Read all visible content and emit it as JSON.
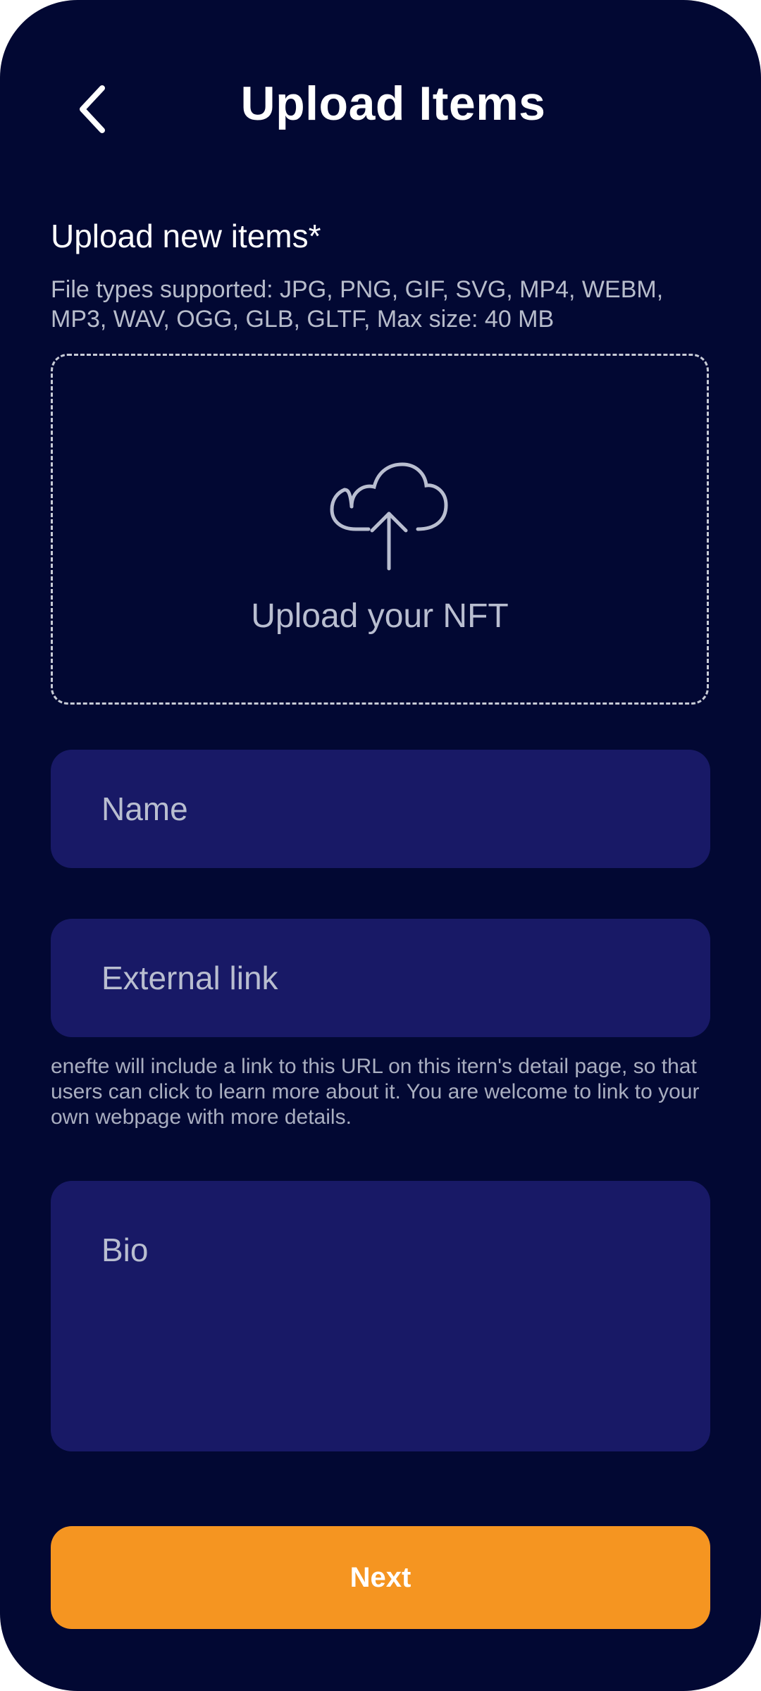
{
  "header": {
    "title": "Upload Items",
    "back_icon": "chevron-left-icon"
  },
  "upload": {
    "section_title": "Upload new items*",
    "description": "File types supported: JPG, PNG, GIF, SVG, MP4, WEBM, MP3, WAV, OGG, GLB, GLTF, Max size: 40 MB",
    "dropzone_label": "Upload your NFT",
    "icon": "cloud-upload-icon"
  },
  "form": {
    "name_placeholder": "Name",
    "name_value": "",
    "link_placeholder": "External link",
    "link_value": "",
    "link_helper": "enefte will include a link to this URL on this itern's detail page, so that users can click to learn more about it. You are welcome to link to your own webpage with more details.",
    "bio_placeholder": "Bio",
    "bio_value": ""
  },
  "actions": {
    "next_label": "Next"
  },
  "colors": {
    "background": "#020833",
    "field": "#181966",
    "accent": "#F59521"
  }
}
